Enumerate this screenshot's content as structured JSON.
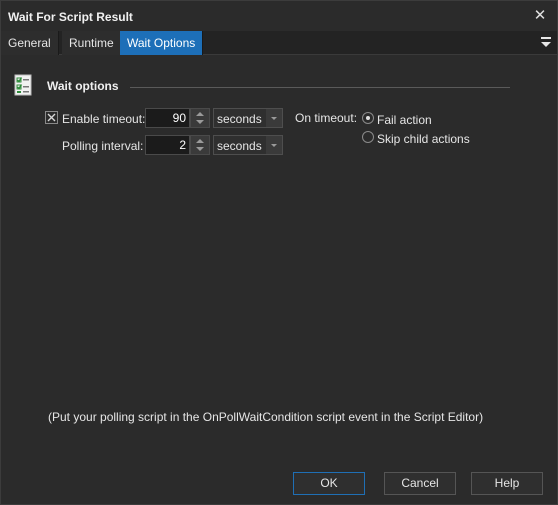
{
  "window": {
    "title": "Wait For Script Result",
    "close_glyph": "✕"
  },
  "tabs": [
    {
      "label": "General",
      "active": false
    },
    {
      "label": "Runtime",
      "active": false
    },
    {
      "label": "Wait Options",
      "active": true
    }
  ],
  "section": {
    "title": "Wait options",
    "icon": "checklist-icon"
  },
  "timeout": {
    "enable_label": "Enable timeout:",
    "enabled": true,
    "value": "90",
    "unit": "seconds"
  },
  "polling": {
    "label": "Polling interval:",
    "value": "2",
    "unit": "seconds"
  },
  "on_timeout": {
    "label": "On timeout:",
    "options": [
      {
        "label": "Fail action",
        "selected": true
      },
      {
        "label": "Skip child actions",
        "selected": false
      }
    ]
  },
  "hint": "(Put your polling script in the OnPollWaitCondition script event in the Script Editor)",
  "buttons": {
    "ok": "OK",
    "cancel": "Cancel",
    "help": "Help"
  },
  "colors": {
    "background": "#2b2b2b",
    "accent": "#1d6fb8",
    "text": "#e6e6e6"
  }
}
